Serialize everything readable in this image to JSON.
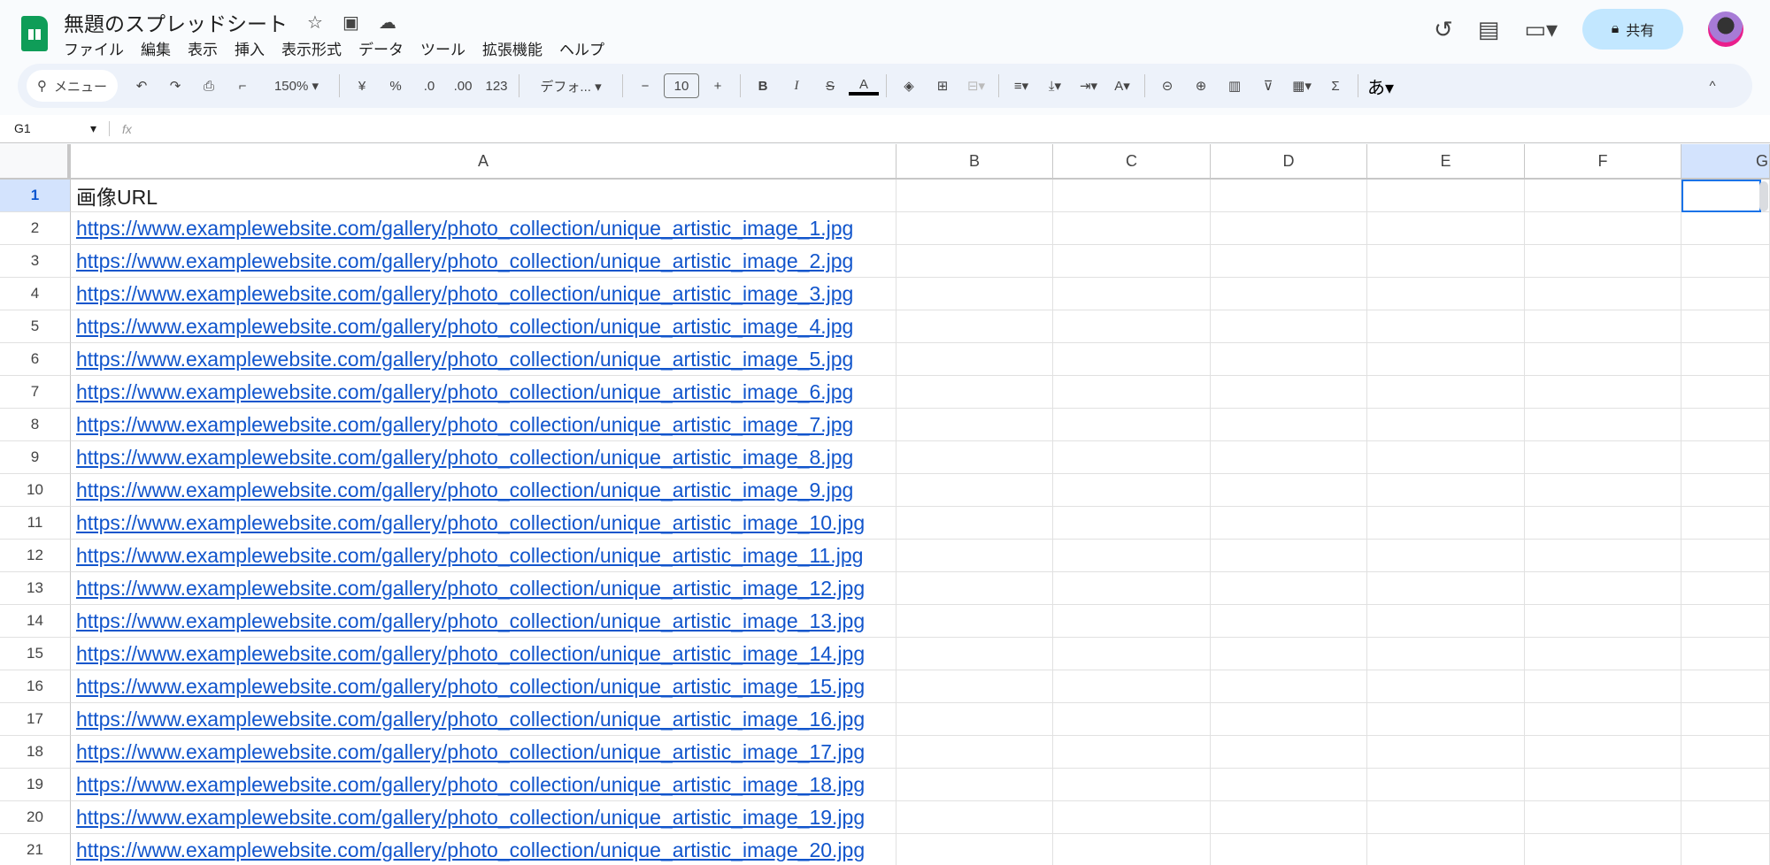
{
  "doc": {
    "title": "無題のスプレッドシート"
  },
  "menu": [
    "ファイル",
    "編集",
    "表示",
    "挿入",
    "表示形式",
    "データ",
    "ツール",
    "拡張機能",
    "ヘルプ"
  ],
  "share_label": "共有",
  "toolbar": {
    "search": "メニュー",
    "zoom": "150%",
    "currency": "¥",
    "percent": "%",
    "dec_less": ".0",
    "dec_more": ".00",
    "format_num": "123",
    "font": "デフォ...",
    "font_size": "10",
    "bold": "B",
    "italic": "I",
    "input_tool": "あ"
  },
  "formula": {
    "namebox": "G1",
    "fx": "fx",
    "value": ""
  },
  "columns": [
    "A",
    "B",
    "C",
    "D",
    "E",
    "F",
    "G"
  ],
  "header_cell": "画像URL",
  "urls": [
    "https://www.examplewebsite.com/gallery/photo_collection/unique_artistic_image_1.jpg",
    "https://www.examplewebsite.com/gallery/photo_collection/unique_artistic_image_2.jpg",
    "https://www.examplewebsite.com/gallery/photo_collection/unique_artistic_image_3.jpg",
    "https://www.examplewebsite.com/gallery/photo_collection/unique_artistic_image_4.jpg",
    "https://www.examplewebsite.com/gallery/photo_collection/unique_artistic_image_5.jpg",
    "https://www.examplewebsite.com/gallery/photo_collection/unique_artistic_image_6.jpg",
    "https://www.examplewebsite.com/gallery/photo_collection/unique_artistic_image_7.jpg",
    "https://www.examplewebsite.com/gallery/photo_collection/unique_artistic_image_8.jpg",
    "https://www.examplewebsite.com/gallery/photo_collection/unique_artistic_image_9.jpg",
    "https://www.examplewebsite.com/gallery/photo_collection/unique_artistic_image_10.jpg",
    "https://www.examplewebsite.com/gallery/photo_collection/unique_artistic_image_11.jpg",
    "https://www.examplewebsite.com/gallery/photo_collection/unique_artistic_image_12.jpg",
    "https://www.examplewebsite.com/gallery/photo_collection/unique_artistic_image_13.jpg",
    "https://www.examplewebsite.com/gallery/photo_collection/unique_artistic_image_14.jpg",
    "https://www.examplewebsite.com/gallery/photo_collection/unique_artistic_image_15.jpg",
    "https://www.examplewebsite.com/gallery/photo_collection/unique_artistic_image_16.jpg",
    "https://www.examplewebsite.com/gallery/photo_collection/unique_artistic_image_17.jpg",
    "https://www.examplewebsite.com/gallery/photo_collection/unique_artistic_image_18.jpg",
    "https://www.examplewebsite.com/gallery/photo_collection/unique_artistic_image_19.jpg",
    "https://www.examplewebsite.com/gallery/photo_collection/unique_artistic_image_20.jpg"
  ],
  "colors": {
    "link": "#1155cc",
    "selection": "#1a73e8",
    "header_selected": "#d3e3fd"
  }
}
